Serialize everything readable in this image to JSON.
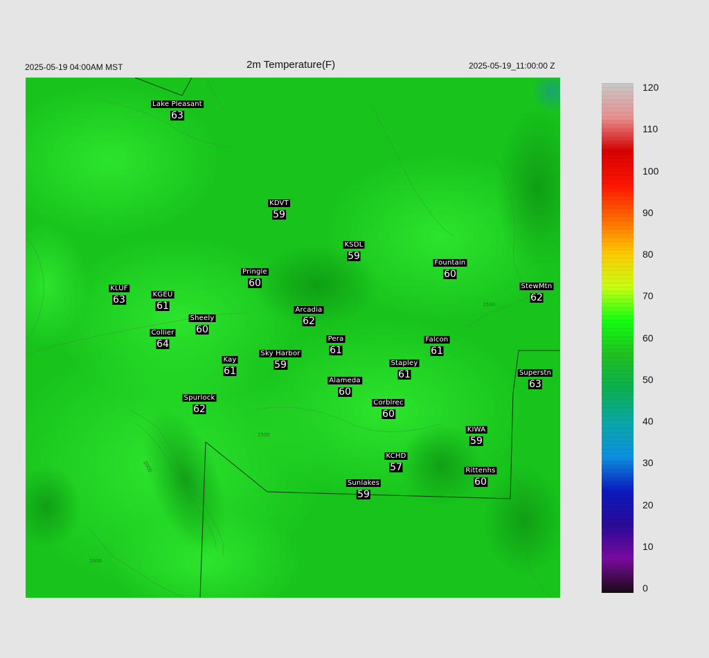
{
  "header": {
    "local_time": "2025-05-19 04:00AM MST",
    "title": "2m Temperature(F)",
    "valid_time": "2025-05-19_11:00:00 Z"
  },
  "map": {
    "field": "2m Temperature(F)",
    "stations": [
      {
        "name": "Lake Pleasant",
        "temp": "63"
      },
      {
        "name": "KDVT",
        "temp": "59"
      },
      {
        "name": "KSDL",
        "temp": "59"
      },
      {
        "name": "Fountain",
        "temp": "60"
      },
      {
        "name": "Pringle",
        "temp": "60"
      },
      {
        "name": "KLUF",
        "temp": "63"
      },
      {
        "name": "KGEU",
        "temp": "61"
      },
      {
        "name": "StewMtn",
        "temp": "62"
      },
      {
        "name": "Arcadia",
        "temp": "62"
      },
      {
        "name": "Sheely",
        "temp": "60"
      },
      {
        "name": "Collier",
        "temp": "64"
      },
      {
        "name": "Pera",
        "temp": "61"
      },
      {
        "name": "Falcon",
        "temp": "61"
      },
      {
        "name": "Kay",
        "temp": "61"
      },
      {
        "name": "Sky Harbor",
        "temp": "59"
      },
      {
        "name": "Stapley",
        "temp": "61"
      },
      {
        "name": "Superstn",
        "temp": "63"
      },
      {
        "name": "Alameda",
        "temp": "60"
      },
      {
        "name": "Spurlock",
        "temp": "62"
      },
      {
        "name": "Corblrec",
        "temp": "60"
      },
      {
        "name": "KIWA",
        "temp": "59"
      },
      {
        "name": "KCHD",
        "temp": "57"
      },
      {
        "name": "Rittenhs",
        "temp": "60"
      },
      {
        "name": "Sunlakes",
        "temp": "59"
      }
    ],
    "contour_labels": [
      "1500",
      "1500",
      "2000",
      "2000"
    ]
  },
  "colorbar": {
    "ticks": [
      "0",
      "10",
      "20",
      "30",
      "40",
      "50",
      "60",
      "70",
      "80",
      "90",
      "100",
      "110",
      "120"
    ],
    "min": 0,
    "max": 120,
    "colors": [
      "#1a0a14",
      "#7a0aa0",
      "#2a0a9a",
      "#0a1ac0",
      "#0a90e0",
      "#0aa8a8",
      "#0ab050",
      "#20c020",
      "#10ff10",
      "#c8ff10",
      "#ffc800",
      "#ff6a00",
      "#ff1400",
      "#d80000",
      "#e89090",
      "#c8c8c8"
    ]
  }
}
